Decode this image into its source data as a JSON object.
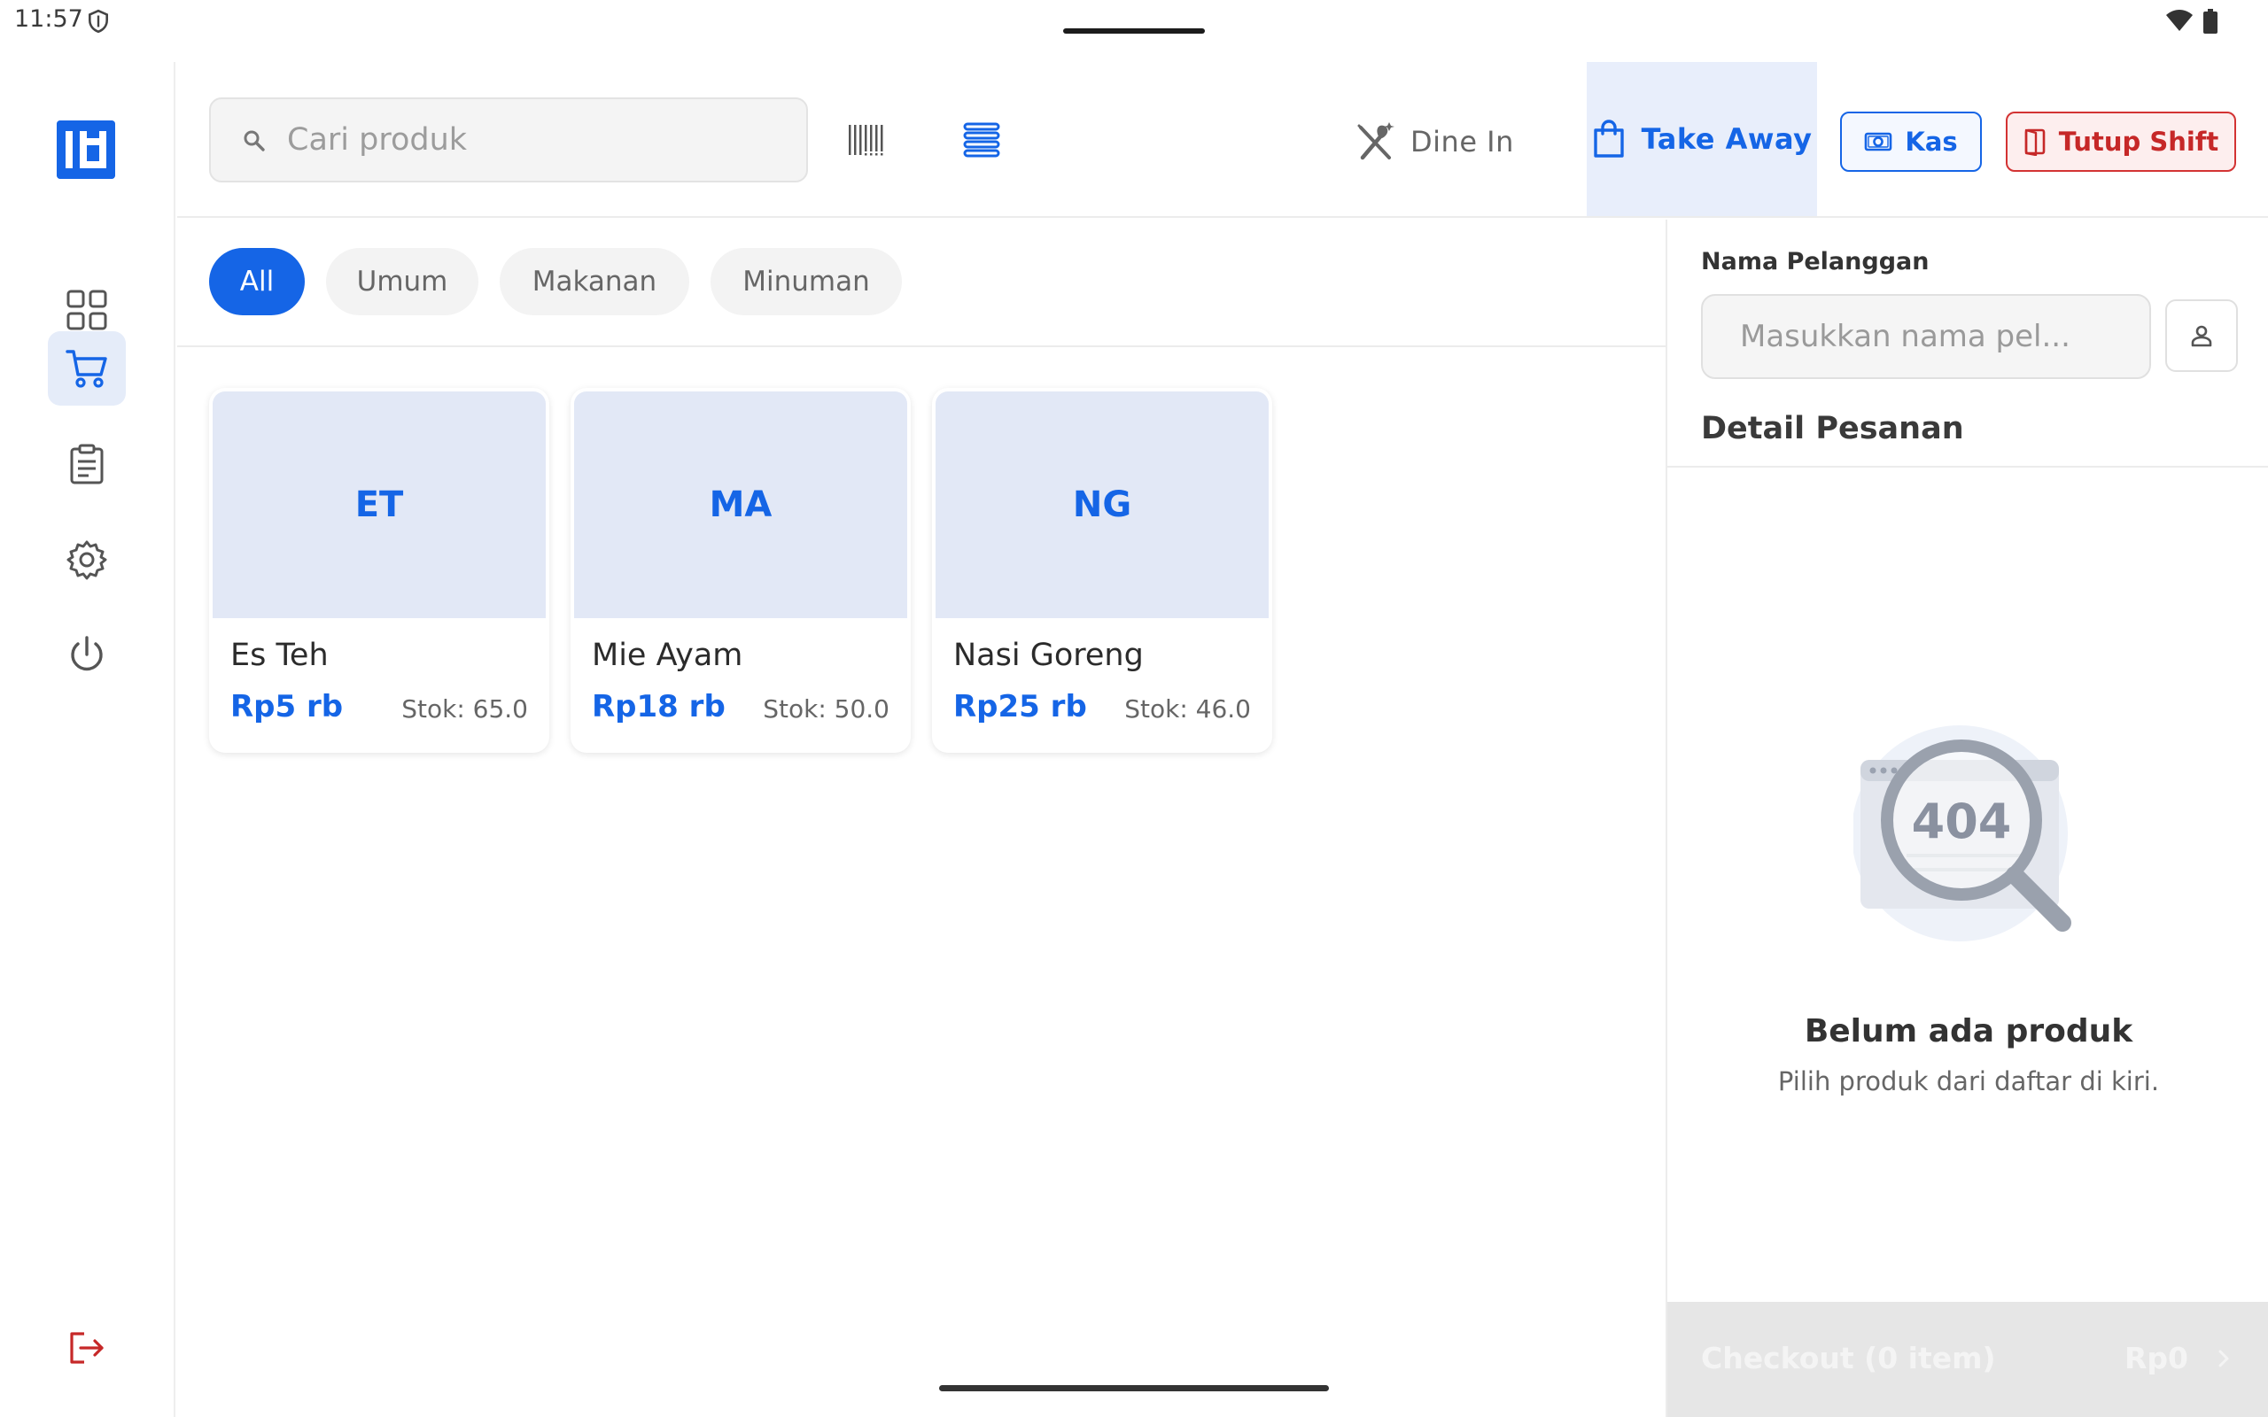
{
  "status_bar": {
    "time": "11:57"
  },
  "search": {
    "placeholder": "Cari produk",
    "value": ""
  },
  "order_types": {
    "dine_in": "Dine In",
    "take_away": "Take Away",
    "selected": "Take Away"
  },
  "actions": {
    "kas": "Kas",
    "tutup_shift": "Tutup Shift"
  },
  "categories": [
    {
      "label": "All",
      "active": true
    },
    {
      "label": "Umum",
      "active": false
    },
    {
      "label": "Makanan",
      "active": false
    },
    {
      "label": "Minuman",
      "active": false
    }
  ],
  "products": [
    {
      "initials": "ET",
      "name": "Es Teh",
      "price": "Rp5 rb",
      "stock": "Stok: 65.0"
    },
    {
      "initials": "MA",
      "name": "Mie Ayam",
      "price": "Rp18 rb",
      "stock": "Stok: 50.0"
    },
    {
      "initials": "NG",
      "name": "Nasi Goreng",
      "price": "Rp25 rb",
      "stock": "Stok: 46.0"
    }
  ],
  "order_panel": {
    "customer_label": "Nama Pelanggan",
    "customer_placeholder": "Masukkan nama pel...",
    "customer_value": "",
    "title": "Detail Pesanan",
    "empty_art_text": "404",
    "empty_title": "Belum ada produk",
    "empty_subtitle": "Pilih produk dari daftar di kiri.",
    "checkout_label": "Checkout (0 item)",
    "checkout_total": "Rp0"
  },
  "sidebar": {
    "items": [
      {
        "name": "dashboard",
        "icon": "grid-icon",
        "active": false
      },
      {
        "name": "cart",
        "icon": "cart-icon",
        "active": true
      },
      {
        "name": "orders",
        "icon": "clipboard-icon",
        "active": false
      },
      {
        "name": "settings",
        "icon": "gear-icon",
        "active": false
      },
      {
        "name": "power",
        "icon": "power-icon",
        "active": false
      }
    ],
    "logout_icon": "logout-icon"
  },
  "colors": {
    "primary": "#1565e6",
    "primary_light": "#e5ecf9",
    "danger": "#c62828",
    "thumb_bg": "#e2e8f6"
  }
}
